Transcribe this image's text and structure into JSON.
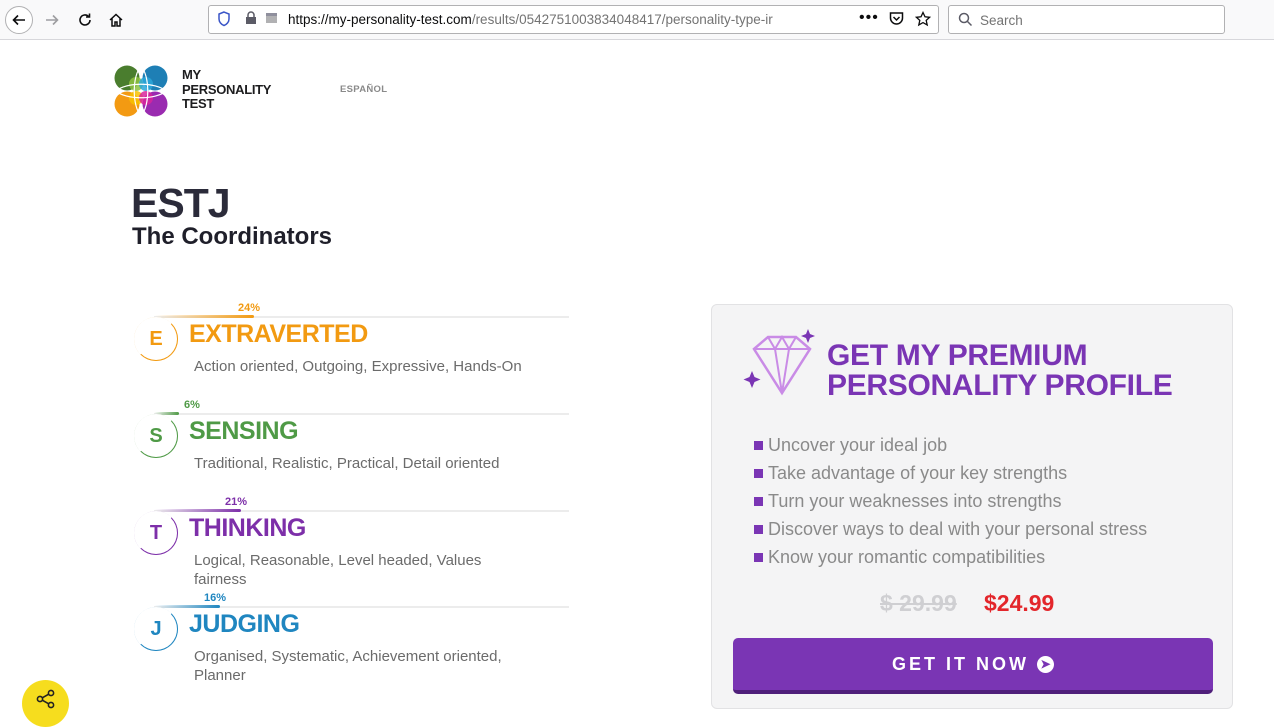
{
  "browser": {
    "url_main": "https://my-personality-test.com",
    "url_rest": "/results/0542751003834048417/personality-type-ir",
    "search_placeholder": "Search"
  },
  "header": {
    "logo_line1": "MY",
    "logo_line2": "PERSONALITY",
    "logo_line3": "TEST",
    "language_link": "ESPAÑOL"
  },
  "result": {
    "type_code": "ESTJ",
    "type_name": "The Coordinators"
  },
  "traits": [
    {
      "letter": "E",
      "name": "EXTRAVERTED",
      "percent": "24%",
      "description": "Action oriented, Outgoing, Expressive, Hands-On",
      "color": "#f29a11",
      "bar_fraction": 0.24
    },
    {
      "letter": "S",
      "name": "SENSING",
      "percent": "6%",
      "description": "Traditional, Realistic, Practical, Detail oriented",
      "color": "#4f9a46",
      "bar_fraction": 0.06
    },
    {
      "letter": "T",
      "name": "THINKING",
      "percent": "21%",
      "description": "Logical, Reasonable, Level headed, Values fairness",
      "color": "#7d2fa9",
      "bar_fraction": 0.21
    },
    {
      "letter": "J",
      "name": "JUDGING",
      "percent": "16%",
      "description": "Organised, Systematic, Achievement oriented, Planner",
      "color": "#1f86c0",
      "bar_fraction": 0.16
    }
  ],
  "premium": {
    "title_line1": "GET MY PREMIUM",
    "title_line2": "PERSONALITY PROFILE",
    "benefits": [
      "Uncover your ideal job",
      "Take advantage of your key strengths",
      "Turn your weaknesses into strengths",
      "Discover ways to deal with your personal stress",
      "Know your romantic compatibilities"
    ],
    "old_price": "$ 29.99",
    "new_price": "$24.99",
    "cta_label": "GET IT NOW"
  }
}
